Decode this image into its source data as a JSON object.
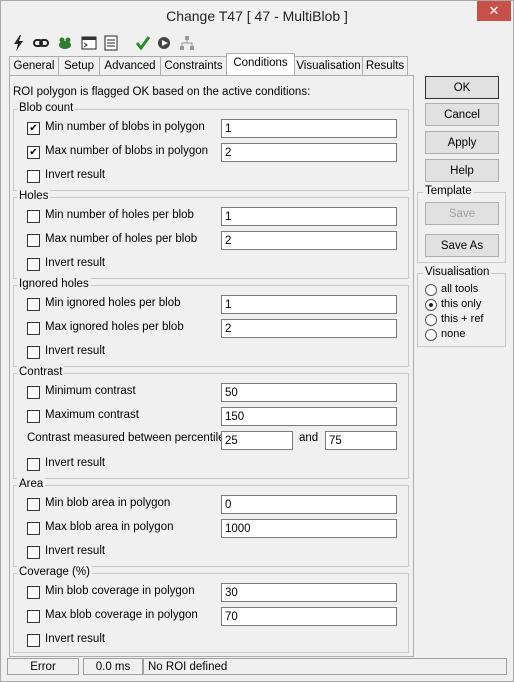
{
  "window": {
    "title": "Change T47 [ 47 - MultiBlob ]",
    "close_glyph": "✕"
  },
  "toolbar": {
    "icons": [
      "lightning-icon",
      "link-icon",
      "frog-icon",
      "console-icon",
      "list-icon",
      "check-icon",
      "run-icon",
      "tree-icon"
    ]
  },
  "tabs": [
    "General",
    "Setup",
    "Advanced",
    "Constraints",
    "Conditions",
    "Visualisation",
    "Results"
  ],
  "active_tab": "Conditions",
  "intro": "ROI polygon is flagged OK based on the active conditions:",
  "groups": {
    "blob_count": {
      "title": "Blob count",
      "min": {
        "label": "Min number of blobs in polygon",
        "checked": true,
        "value": "1"
      },
      "max": {
        "label": "Max number of blobs in polygon",
        "checked": true,
        "value": "2"
      },
      "invert": {
        "label": "Invert result",
        "checked": false
      }
    },
    "holes": {
      "title": "Holes",
      "min": {
        "label": "Min number of holes per blob",
        "checked": false,
        "value": "1"
      },
      "max": {
        "label": "Max number of holes per blob",
        "checked": false,
        "value": "2"
      },
      "invert": {
        "label": "Invert result",
        "checked": false
      }
    },
    "ignored_holes": {
      "title": "Ignored holes",
      "min": {
        "label": "Min ignored holes per blob",
        "checked": false,
        "value": "1"
      },
      "max": {
        "label": "Max ignored holes per blob",
        "checked": false,
        "value": "2"
      },
      "invert": {
        "label": "Invert result",
        "checked": false
      }
    },
    "contrast": {
      "title": "Contrast",
      "min": {
        "label": "Minimum contrast",
        "checked": false,
        "value": "50"
      },
      "max": {
        "label": "Maximum contrast",
        "checked": false,
        "value": "150"
      },
      "percentiles": {
        "label": "Contrast measured between percentiles",
        "low": "25",
        "and_label": "and",
        "high": "75"
      },
      "invert": {
        "label": "Invert result",
        "checked": false
      }
    },
    "area": {
      "title": "Area",
      "min": {
        "label": "Min blob area in polygon",
        "checked": false,
        "value": "0"
      },
      "max": {
        "label": "Max blob area in polygon",
        "checked": false,
        "value": "1000"
      },
      "invert": {
        "label": "Invert result",
        "checked": false
      }
    },
    "coverage": {
      "title": "Coverage (%)",
      "min": {
        "label": "Min blob coverage in polygon",
        "checked": false,
        "value": "30"
      },
      "max": {
        "label": "Max blob coverage in polygon",
        "checked": false,
        "value": "70"
      },
      "invert": {
        "label": "Invert result",
        "checked": false
      }
    }
  },
  "buttons": {
    "ok": "OK",
    "cancel": "Cancel",
    "apply": "Apply",
    "help": "Help"
  },
  "template": {
    "title": "Template",
    "save": "Save",
    "save_as": "Save As"
  },
  "visualisation": {
    "title": "Visualisation",
    "options": [
      "all tools",
      "this only",
      "this + ref",
      "none"
    ],
    "selected": "this only"
  },
  "status": {
    "state": "Error",
    "time": "0.0 ms",
    "message": "No ROI defined"
  },
  "colors": {
    "close": "#c7504a",
    "check": "#2a8a2a",
    "lightning": "#222222"
  }
}
